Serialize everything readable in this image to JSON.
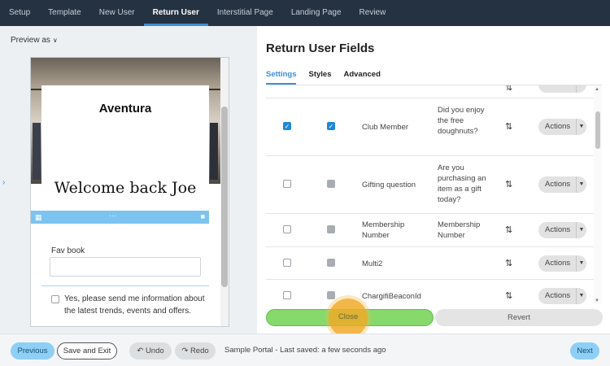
{
  "nav": {
    "tabs": [
      "Setup",
      "Template",
      "New User",
      "Return User",
      "Interstitial Page",
      "Landing Page",
      "Review"
    ],
    "active_index": 3
  },
  "preview": {
    "label": "Preview as",
    "brand": "Aventura",
    "welcome": "Welcome back Joe",
    "field_label": "Fav book",
    "optin_text": "Yes, please send me information about the latest trends, events and offers."
  },
  "panel": {
    "title": "Return User Fields",
    "subtabs": [
      "Settings",
      "Styles",
      "Advanced"
    ],
    "active_subtab": 0,
    "rows": [
      {
        "name": "",
        "question": "",
        "cb1": "none",
        "cb2": "none",
        "actions": ""
      },
      {
        "name": "Club Member",
        "question": "Did you enjoy the free doughnuts?",
        "cb1": "checked",
        "cb2": "checked",
        "actions": "Actions"
      },
      {
        "name": "Gifting question",
        "question": "Are you purchasing an item as a gift today?",
        "cb1": "unchecked",
        "cb2": "disabled",
        "actions": "Actions"
      },
      {
        "name": "Membership Number",
        "question": "Membership Number",
        "cb1": "unchecked",
        "cb2": "disabled",
        "actions": "Actions"
      },
      {
        "name": "Multi2",
        "question": "",
        "cb1": "unchecked",
        "cb2": "disabled",
        "actions": "Actions"
      },
      {
        "name": "ChargifiBeaconId",
        "question": "",
        "cb1": "unchecked",
        "cb2": "disabled",
        "actions": "Actions"
      }
    ],
    "close_label": "Close",
    "revert_label": "Revert",
    "highlight_label": "Close"
  },
  "footer": {
    "previous": "Previous",
    "save_exit": "Save and Exit",
    "undo": "Undo",
    "redo": "Redo",
    "status": "Sample Portal - Last saved: a few seconds ago",
    "next": "Next"
  },
  "icons": {
    "sort": "sort-arrows-icon",
    "caret": "caret-down-icon",
    "undo": "undo-icon",
    "redo": "redo-icon",
    "grid": "grid-icon",
    "trash": "trash-icon",
    "drag": "drag-dots-icon",
    "chevron": "chevron-down-icon"
  },
  "colors": {
    "nav_bg": "#243242",
    "accent": "#3d8fd6",
    "close_green": "#86d96a",
    "highlight": "#f0aa28"
  }
}
